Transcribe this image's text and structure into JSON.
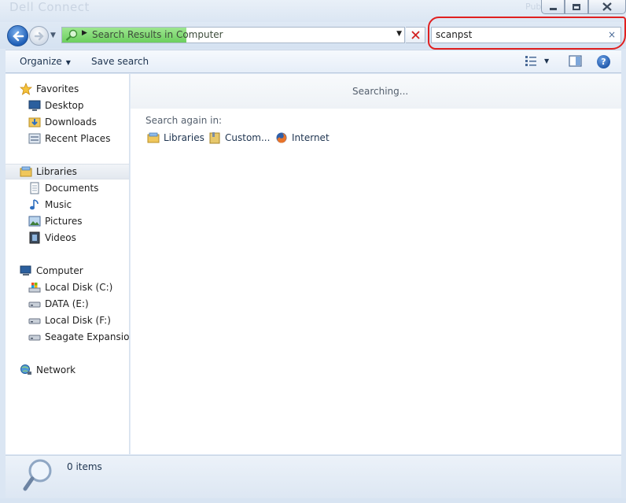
{
  "window": {
    "title_ghost": "Dell Connect",
    "title_ghost_right": "Publish",
    "controls": {
      "minimize": "minimize-icon",
      "restore": "restore-icon",
      "close": "close-icon"
    }
  },
  "address": {
    "crumb": "Search Results in Computer",
    "highlight_color": "#7fdc6f"
  },
  "search": {
    "value": "scanpst",
    "clear_glyph": "×",
    "annotation_color": "#e02020"
  },
  "toolbar": {
    "organize_label": "Organize",
    "save_search_label": "Save search",
    "help_label": "?"
  },
  "nav": {
    "favorites": {
      "label": "Favorites",
      "items": [
        "Desktop",
        "Downloads",
        "Recent Places"
      ]
    },
    "libraries": {
      "label": "Libraries",
      "items": [
        "Documents",
        "Music",
        "Pictures",
        "Videos"
      ]
    },
    "computer": {
      "label": "Computer",
      "items": [
        "Local Disk (C:)",
        "DATA (E:)",
        "Local Disk (F:)",
        "Seagate Expansion D"
      ]
    },
    "network": {
      "label": "Network"
    }
  },
  "content": {
    "status": "Searching...",
    "search_again_label": "Search again in:",
    "search_again_options": [
      "Libraries",
      "Custom...",
      "Internet"
    ]
  },
  "details": {
    "item_count": "0 items"
  }
}
